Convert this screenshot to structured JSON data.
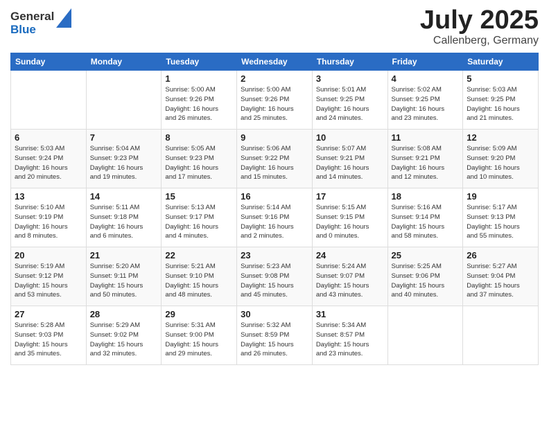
{
  "logo": {
    "general": "General",
    "blue": "Blue"
  },
  "title": "July 2025",
  "subtitle": "Callenberg, Germany",
  "weekdays": [
    "Sunday",
    "Monday",
    "Tuesday",
    "Wednesday",
    "Thursday",
    "Friday",
    "Saturday"
  ],
  "weeks": [
    [
      {
        "day": "",
        "detail": ""
      },
      {
        "day": "",
        "detail": ""
      },
      {
        "day": "1",
        "detail": "Sunrise: 5:00 AM\nSunset: 9:26 PM\nDaylight: 16 hours\nand 26 minutes."
      },
      {
        "day": "2",
        "detail": "Sunrise: 5:00 AM\nSunset: 9:26 PM\nDaylight: 16 hours\nand 25 minutes."
      },
      {
        "day": "3",
        "detail": "Sunrise: 5:01 AM\nSunset: 9:25 PM\nDaylight: 16 hours\nand 24 minutes."
      },
      {
        "day": "4",
        "detail": "Sunrise: 5:02 AM\nSunset: 9:25 PM\nDaylight: 16 hours\nand 23 minutes."
      },
      {
        "day": "5",
        "detail": "Sunrise: 5:03 AM\nSunset: 9:25 PM\nDaylight: 16 hours\nand 21 minutes."
      }
    ],
    [
      {
        "day": "6",
        "detail": "Sunrise: 5:03 AM\nSunset: 9:24 PM\nDaylight: 16 hours\nand 20 minutes."
      },
      {
        "day": "7",
        "detail": "Sunrise: 5:04 AM\nSunset: 9:23 PM\nDaylight: 16 hours\nand 19 minutes."
      },
      {
        "day": "8",
        "detail": "Sunrise: 5:05 AM\nSunset: 9:23 PM\nDaylight: 16 hours\nand 17 minutes."
      },
      {
        "day": "9",
        "detail": "Sunrise: 5:06 AM\nSunset: 9:22 PM\nDaylight: 16 hours\nand 15 minutes."
      },
      {
        "day": "10",
        "detail": "Sunrise: 5:07 AM\nSunset: 9:21 PM\nDaylight: 16 hours\nand 14 minutes."
      },
      {
        "day": "11",
        "detail": "Sunrise: 5:08 AM\nSunset: 9:21 PM\nDaylight: 16 hours\nand 12 minutes."
      },
      {
        "day": "12",
        "detail": "Sunrise: 5:09 AM\nSunset: 9:20 PM\nDaylight: 16 hours\nand 10 minutes."
      }
    ],
    [
      {
        "day": "13",
        "detail": "Sunrise: 5:10 AM\nSunset: 9:19 PM\nDaylight: 16 hours\nand 8 minutes."
      },
      {
        "day": "14",
        "detail": "Sunrise: 5:11 AM\nSunset: 9:18 PM\nDaylight: 16 hours\nand 6 minutes."
      },
      {
        "day": "15",
        "detail": "Sunrise: 5:13 AM\nSunset: 9:17 PM\nDaylight: 16 hours\nand 4 minutes."
      },
      {
        "day": "16",
        "detail": "Sunrise: 5:14 AM\nSunset: 9:16 PM\nDaylight: 16 hours\nand 2 minutes."
      },
      {
        "day": "17",
        "detail": "Sunrise: 5:15 AM\nSunset: 9:15 PM\nDaylight: 16 hours\nand 0 minutes."
      },
      {
        "day": "18",
        "detail": "Sunrise: 5:16 AM\nSunset: 9:14 PM\nDaylight: 15 hours\nand 58 minutes."
      },
      {
        "day": "19",
        "detail": "Sunrise: 5:17 AM\nSunset: 9:13 PM\nDaylight: 15 hours\nand 55 minutes."
      }
    ],
    [
      {
        "day": "20",
        "detail": "Sunrise: 5:19 AM\nSunset: 9:12 PM\nDaylight: 15 hours\nand 53 minutes."
      },
      {
        "day": "21",
        "detail": "Sunrise: 5:20 AM\nSunset: 9:11 PM\nDaylight: 15 hours\nand 50 minutes."
      },
      {
        "day": "22",
        "detail": "Sunrise: 5:21 AM\nSunset: 9:10 PM\nDaylight: 15 hours\nand 48 minutes."
      },
      {
        "day": "23",
        "detail": "Sunrise: 5:23 AM\nSunset: 9:08 PM\nDaylight: 15 hours\nand 45 minutes."
      },
      {
        "day": "24",
        "detail": "Sunrise: 5:24 AM\nSunset: 9:07 PM\nDaylight: 15 hours\nand 43 minutes."
      },
      {
        "day": "25",
        "detail": "Sunrise: 5:25 AM\nSunset: 9:06 PM\nDaylight: 15 hours\nand 40 minutes."
      },
      {
        "day": "26",
        "detail": "Sunrise: 5:27 AM\nSunset: 9:04 PM\nDaylight: 15 hours\nand 37 minutes."
      }
    ],
    [
      {
        "day": "27",
        "detail": "Sunrise: 5:28 AM\nSunset: 9:03 PM\nDaylight: 15 hours\nand 35 minutes."
      },
      {
        "day": "28",
        "detail": "Sunrise: 5:29 AM\nSunset: 9:02 PM\nDaylight: 15 hours\nand 32 minutes."
      },
      {
        "day": "29",
        "detail": "Sunrise: 5:31 AM\nSunset: 9:00 PM\nDaylight: 15 hours\nand 29 minutes."
      },
      {
        "day": "30",
        "detail": "Sunrise: 5:32 AM\nSunset: 8:59 PM\nDaylight: 15 hours\nand 26 minutes."
      },
      {
        "day": "31",
        "detail": "Sunrise: 5:34 AM\nSunset: 8:57 PM\nDaylight: 15 hours\nand 23 minutes."
      },
      {
        "day": "",
        "detail": ""
      },
      {
        "day": "",
        "detail": ""
      }
    ]
  ]
}
